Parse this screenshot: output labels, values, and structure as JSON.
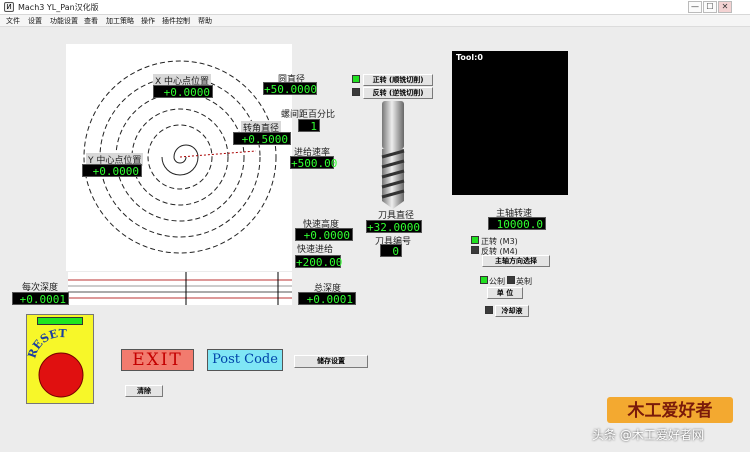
{
  "window": {
    "title": "Mach3 YL_Pan汉化版",
    "icon_glyph": "Ͷ",
    "min": "—",
    "max": "☐",
    "close": "✕"
  },
  "menu": [
    "文件",
    "设置",
    "功能设置",
    "查看",
    "加工策略",
    "操作",
    "插件控制",
    "帮助"
  ],
  "fields": {
    "x_center": {
      "label": "X 中心点位置",
      "value": "+0.0000"
    },
    "y_center": {
      "label": "Y 中心点位置",
      "value": "+0.0000"
    },
    "circle_dia": {
      "label": "圆直径",
      "value": "+50.0000"
    },
    "spiral_pct": {
      "label": "螺间距百分比",
      "value": "1"
    },
    "corner_dia": {
      "label": "转角直径",
      "value": "+0.5000"
    },
    "feed_rate": {
      "label": "进给速率",
      "value": "+500.00"
    },
    "rapid_height": {
      "label": "快速高度",
      "value": "+0.0000"
    },
    "rapid_feed": {
      "label": "快速进给",
      "value": "+200.00"
    },
    "step_depth": {
      "label": "每次深度",
      "value": "+0.0001"
    },
    "total_depth": {
      "label": "总深度",
      "value": "+0.0001"
    },
    "tool_dia": {
      "label": "刀具直径",
      "value": "+32.0000"
    },
    "tool_num": {
      "label": "刀具编号",
      "value": "0"
    },
    "spindle_speed": {
      "label": "主轴转速",
      "value": "10000.0"
    }
  },
  "buttons": {
    "cw": "正转 (顺铣切削)",
    "ccw": "反转 (逆铣切削)",
    "spindle_dir": "主轴方向选择",
    "units": "单 位",
    "coolant": "冷却液",
    "save": "储存设置",
    "clear": "清除",
    "exit": "EXIT",
    "post": "Post Code",
    "reset": "RESET"
  },
  "radios": {
    "m3": "正转 (M3)",
    "m4": "反转 (M4)",
    "metric": "公制",
    "imperial": "英制"
  },
  "tool_display": "Tool:0",
  "watermark": "头条 @木工爱好者网",
  "logo_text": "木工爱好者",
  "colors": {
    "dro_text": "#31ff31",
    "led_on": "#21e021",
    "exit_bg": "#f27b6e",
    "post_bg": "#7fe6f5",
    "reset_bg": "#f7f729"
  }
}
